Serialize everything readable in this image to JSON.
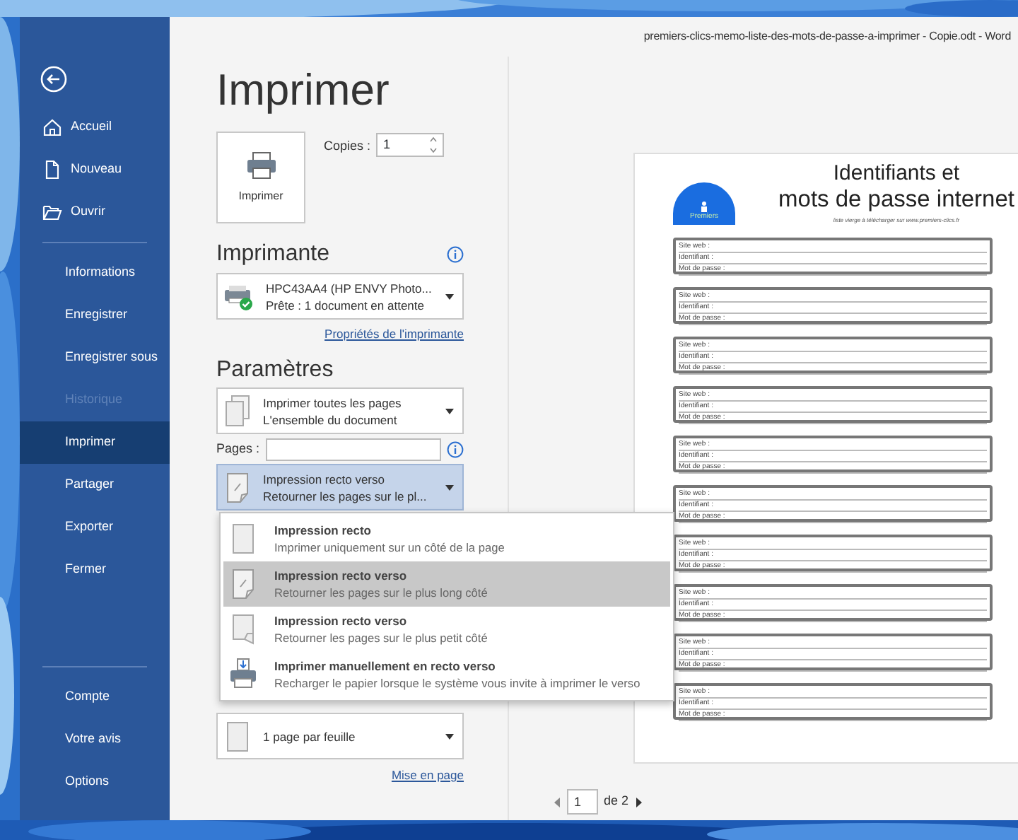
{
  "window": {
    "title": "premiers-clics-memo-liste-des-mots-de-passe-a-imprimer - Copie.odt  -  Word"
  },
  "sidebar": {
    "sections": [
      {
        "items": [
          {
            "label": "Accueil",
            "selected": false,
            "disabled": false
          },
          {
            "label": "Nouveau",
            "selected": false,
            "disabled": false
          },
          {
            "label": "Ouvrir",
            "selected": false,
            "disabled": false
          }
        ]
      },
      {
        "items": [
          {
            "label": "Informations",
            "selected": false,
            "disabled": false
          },
          {
            "label": "Enregistrer",
            "selected": false,
            "disabled": false
          },
          {
            "label": "Enregistrer sous",
            "selected": false,
            "disabled": false
          },
          {
            "label": "Historique",
            "selected": false,
            "disabled": true
          },
          {
            "label": "Imprimer",
            "selected": true,
            "disabled": false
          },
          {
            "label": "Partager",
            "selected": false,
            "disabled": false
          },
          {
            "label": "Exporter",
            "selected": false,
            "disabled": false
          },
          {
            "label": "Fermer",
            "selected": false,
            "disabled": false
          }
        ]
      },
      {
        "items": [
          {
            "label": "Compte",
            "selected": false,
            "disabled": false
          },
          {
            "label": "Votre avis",
            "selected": false,
            "disabled": false
          },
          {
            "label": "Options",
            "selected": false,
            "disabled": false
          }
        ]
      }
    ]
  },
  "heading": "Imprimer",
  "print_button": {
    "label": "Imprimer"
  },
  "copies": {
    "label": "Copies :",
    "value": "1"
  },
  "printer": {
    "heading": "Imprimante",
    "name": "HPC43AA4 (HP ENVY Photo...",
    "status": "Prête : 1 document en attente",
    "ready": true,
    "properties_link": "Propriétés de l'imprimante"
  },
  "settings": {
    "heading": "Paramètres",
    "pages_dropdown": {
      "title": "Imprimer toutes les pages",
      "subtitle": "L'ensemble du document"
    },
    "pages": {
      "label": "Pages :"
    },
    "duplex_dropdown": {
      "title": "Impression recto verso",
      "subtitle": "Retourner les pages sur le pl...",
      "expanded": true
    },
    "duplex_menu": {
      "items": [
        {
          "kind": "single",
          "title": "Impression recto",
          "subtitle": "Imprimer uniquement sur un côté de la page",
          "selected": false
        },
        {
          "kind": "long",
          "title": "Impression recto verso",
          "subtitle": "Retourner les pages sur le plus long côté",
          "selected": true
        },
        {
          "kind": "short",
          "title": "Impression recto verso",
          "subtitle": "Retourner les pages sur le plus petit côté",
          "selected": false
        },
        {
          "kind": "manual",
          "title": "Imprimer manuellement en recto verso",
          "subtitle": "Recharger le papier lorsque le système vous invite à imprimer le verso",
          "selected": false
        }
      ]
    },
    "sheet_dropdown": {
      "title": "1 page par feuille"
    },
    "page_setup_link": "Mise en page"
  },
  "preview": {
    "document": {
      "logo": "Premiers",
      "title_lines": [
        "Identifiants et",
        "mots de passe internet"
      ],
      "subtitle": "liste vierge à télécharger sur www.premiers-clics.fr",
      "entries": [
        {
          "fields": [
            "Site web :",
            "Identifiant :",
            "Mot de passe :"
          ]
        },
        {
          "fields": [
            "Site web :",
            "Identifiant :",
            "Mot de passe :"
          ]
        },
        {
          "fields": [
            "Site web :",
            "Identifiant :",
            "Mot de passe :"
          ]
        },
        {
          "fields": [
            "Site web :",
            "Identifiant :",
            "Mot de passe :"
          ]
        },
        {
          "fields": [
            "Site web :",
            "Identifiant :",
            "Mot de passe :"
          ]
        },
        {
          "fields": [
            "Site web :",
            "Identifiant :",
            "Mot de passe :"
          ]
        },
        {
          "fields": [
            "Site web :",
            "Identifiant :",
            "Mot de passe :"
          ]
        },
        {
          "fields": [
            "Site web :",
            "Identifiant :",
            "Mot de passe :"
          ]
        },
        {
          "fields": [
            "Site web :",
            "Identifiant :",
            "Mot de passe :"
          ]
        },
        {
          "fields": [
            "Site web :",
            "Identifiant :",
            "Mot de passe :"
          ]
        }
      ]
    },
    "pager": {
      "page": "1",
      "total": "de 2"
    }
  }
}
